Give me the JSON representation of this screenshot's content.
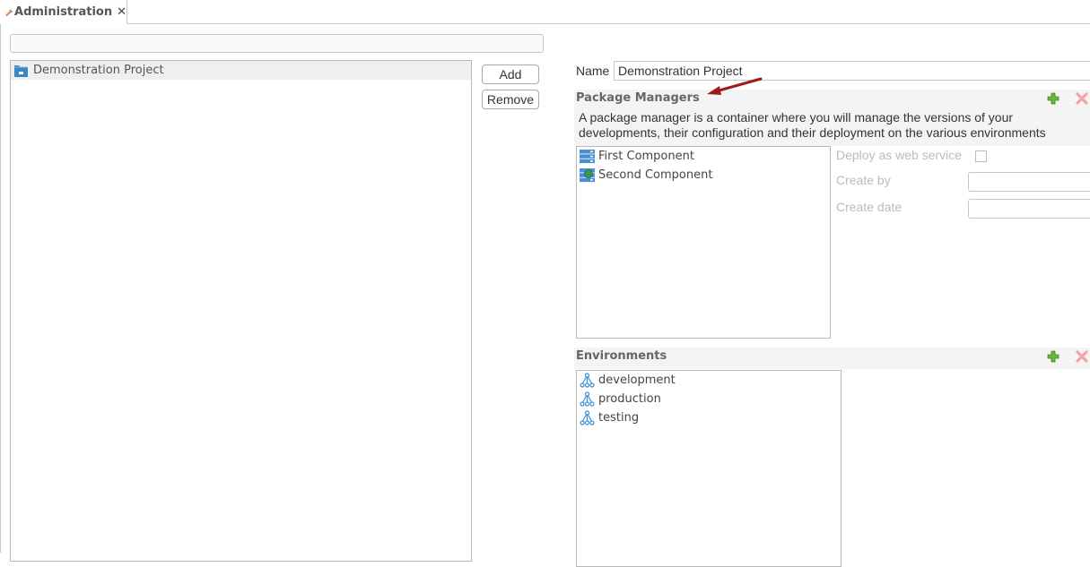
{
  "tab": {
    "label": "Administration",
    "close": "✕",
    "icon": "wrench-icon"
  },
  "projects": {
    "filter_value": "",
    "items": [
      {
        "label": "Demonstration Project",
        "icon": "folder-icon"
      }
    ]
  },
  "buttons": {
    "add": "Add",
    "remove": "Remove"
  },
  "detail": {
    "name_label": "Name",
    "name_value": "Demonstration Project"
  },
  "package_managers": {
    "title": "Package Managers",
    "description": "A package manager is a container where you will manage the versions of your developments, their configuration and their deployment on the various environments",
    "items": [
      {
        "label": "First Component",
        "icon": "server-icon"
      },
      {
        "label": "Second Component",
        "icon": "server-web-icon"
      }
    ],
    "fields": {
      "deploy_label": "Deploy as web service",
      "deploy_checked": false,
      "create_by_label": "Create by",
      "create_by_value": "",
      "create_date_label": "Create date",
      "create_date_value": ""
    }
  },
  "environments": {
    "title": "Environments",
    "items": [
      {
        "label": "development",
        "icon": "network-icon"
      },
      {
        "label": "production",
        "icon": "network-icon"
      },
      {
        "label": "testing",
        "icon": "network-icon"
      }
    ]
  },
  "colors": {
    "accent_blue": "#3a87c8",
    "add_green": "#5aa53b",
    "delete_pink": "#f4a4a4",
    "annotation_arrow": "#9e1b1b"
  }
}
